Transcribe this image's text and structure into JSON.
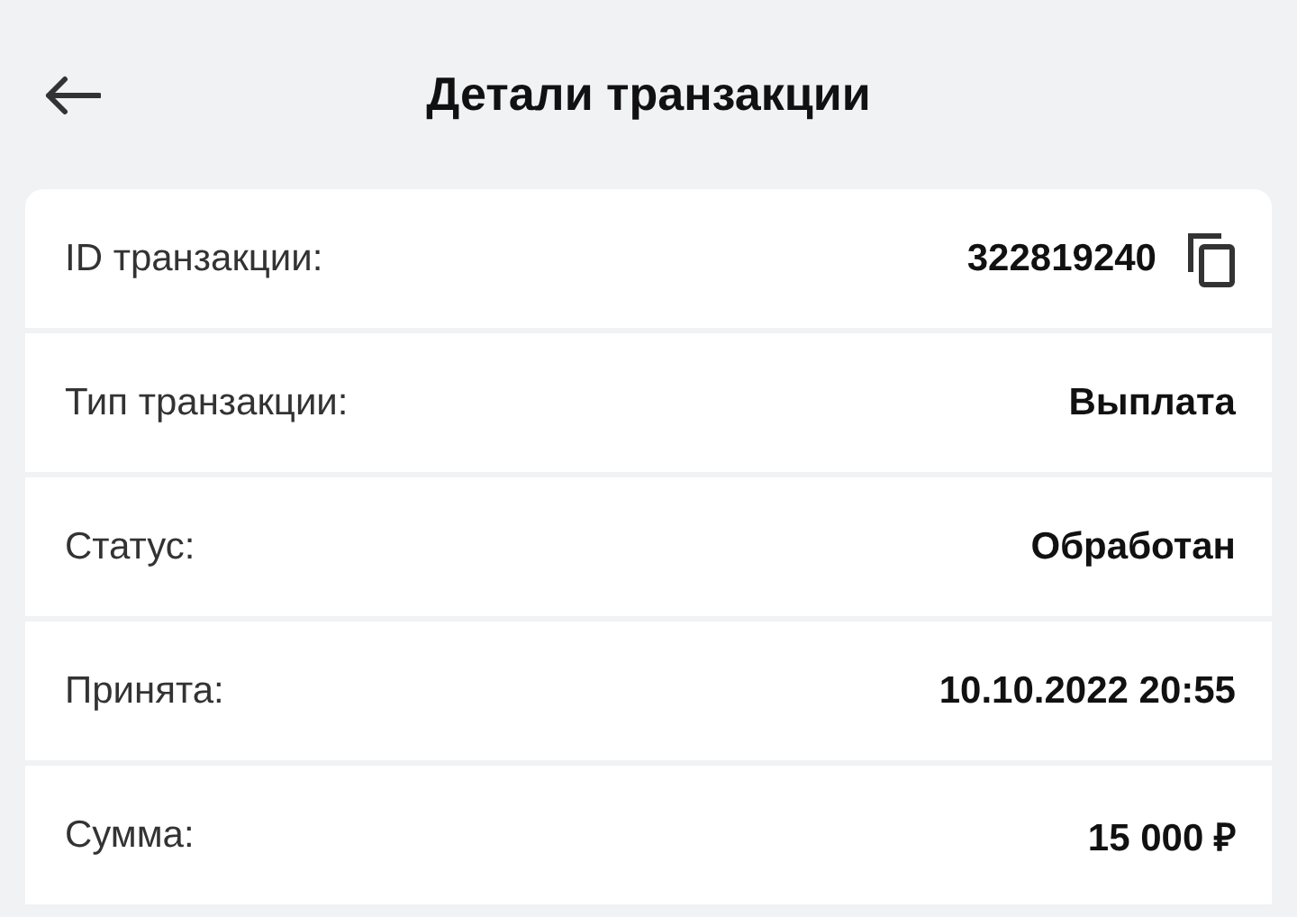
{
  "header": {
    "title": "Детали транзакции"
  },
  "rows": [
    {
      "label": "ID транзакции:",
      "value": "322819240",
      "copyable": true
    },
    {
      "label": "Тип транзакции:",
      "value": "Выплата",
      "copyable": false
    },
    {
      "label": "Статус:",
      "value": "Обработан",
      "copyable": false
    },
    {
      "label": "Принята:",
      "value": "10.10.2022 20:55",
      "copyable": false
    },
    {
      "label": "Сумма:",
      "value": "15 000 ₽",
      "copyable": false
    }
  ]
}
